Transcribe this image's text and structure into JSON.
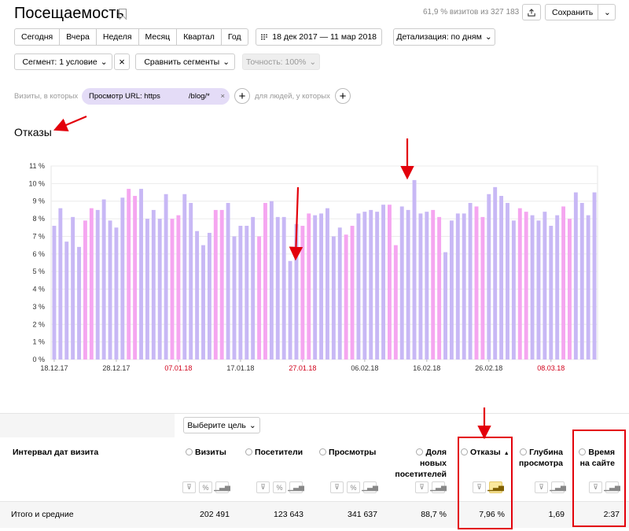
{
  "header": {
    "title": "Посещаемость",
    "visits_info": "61,9 % визитов из 327 183",
    "save_label": "Сохранить"
  },
  "periods": [
    "Сегодня",
    "Вчера",
    "Неделя",
    "Месяц",
    "Квартал",
    "Год"
  ],
  "date_range": "18 дек 2017 — 11 мар 2018",
  "detail_label": "Детализация: по дням",
  "segment_label": "Сегмент: 1 условие",
  "compare_label": "Сравнить сегменты",
  "accuracy_label": "Точность: 100%",
  "filter_bar": {
    "visits_label": "Визиты, в которых",
    "chip_label": "Просмотр URL: https",
    "chip_suffix": "/blog/*",
    "people_label": "для людей, у которых"
  },
  "section_title": "Отказы",
  "chart_data": {
    "type": "bar",
    "y_ticks": [
      "11 %",
      "10 %",
      "9 %",
      "8 %",
      "7 %",
      "6 %",
      "5 %",
      "4 %",
      "3 %",
      "2 %",
      "1 %",
      "0 %"
    ],
    "ylim": [
      0,
      11
    ],
    "x_tick_labels": [
      "18.12.17",
      "28.12.17",
      "07.01.18",
      "17.01.18",
      "27.01.18",
      "06.02.18",
      "16.02.18",
      "26.02.18",
      "08.03.18"
    ],
    "x_tick_colors": [
      "#333333",
      "#333333",
      "#d0021b",
      "#333333",
      "#d0021b",
      "#333333",
      "#333333",
      "#333333",
      "#d0021b"
    ],
    "values": [
      7.6,
      8.6,
      6.7,
      8.1,
      6.4,
      7.9,
      8.6,
      8.5,
      9.1,
      7.9,
      7.5,
      9.2,
      9.7,
      9.3,
      9.7,
      8.0,
      8.5,
      8.0,
      9.4,
      8.0,
      8.2,
      9.4,
      8.9,
      7.3,
      6.5,
      7.2,
      8.5,
      8.5,
      8.9,
      7.0,
      7.6,
      7.6,
      8.1,
      7.0,
      8.9,
      9.0,
      8.1,
      8.1,
      5.6,
      7.7,
      7.6,
      8.3,
      8.2,
      8.3,
      8.6,
      7.0,
      7.5,
      7.1,
      7.6,
      8.3,
      8.4,
      8.5,
      8.4,
      8.8,
      8.8,
      6.5,
      8.7,
      8.5,
      10.2,
      8.3,
      8.4,
      8.5,
      8.1,
      6.1,
      7.9,
      8.3,
      8.3,
      8.9,
      8.7,
      8.1,
      9.4,
      9.8,
      9.3,
      8.9,
      7.9,
      8.6,
      8.4,
      8.2,
      7.9,
      8.4,
      7.6,
      8.2,
      8.7,
      8.0,
      9.5,
      8.9,
      8.2,
      9.5
    ],
    "bar_colors": [
      "#c8b8f5",
      "#f5a6f0"
    ],
    "grid": true
  },
  "table": {
    "goal_button": "Выберите цель",
    "row_header": "Интервал дат визита",
    "columns": [
      {
        "title": "Визиты",
        "value": "202 491"
      },
      {
        "title": "Посетители",
        "value": "123 643"
      },
      {
        "title": "Просмотры",
        "value": "341 637"
      },
      {
        "title_lines": [
          "Доля",
          "новых",
          "посетителей"
        ],
        "value": "88,7 %"
      },
      {
        "title": "Отказы",
        "value": "7,96 %"
      },
      {
        "title_lines": [
          "Глубина",
          "просмотра"
        ],
        "value": "1,69"
      },
      {
        "title_lines": [
          "Время",
          "на сайте"
        ],
        "value": "2:37"
      }
    ],
    "total_label": "Итого и средние"
  },
  "colors": {
    "annotation_red": "#e3000b",
    "weekday_bar": "#c8b8f5",
    "weekend_bar": "#f5a6f0"
  }
}
